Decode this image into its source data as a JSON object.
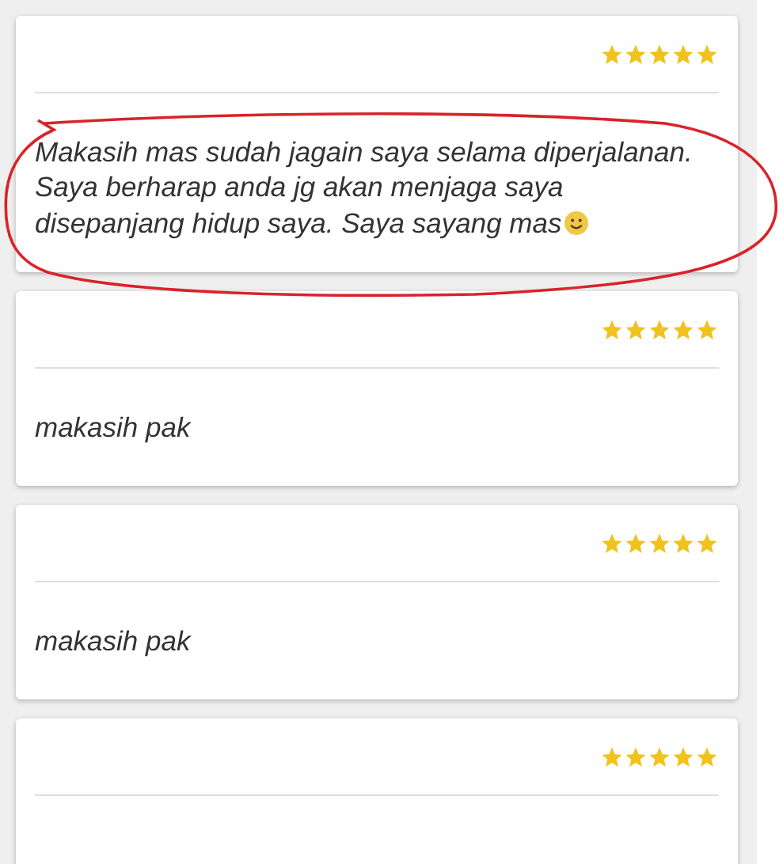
{
  "reviews": [
    {
      "stars": 5,
      "text": "Makasih mas sudah jagain saya selama diperjalanan. Saya berharap anda jg akan menjaga saya disepanjang hidup saya. Saya sayang mas",
      "smiley": true
    },
    {
      "stars": 5,
      "text": "makasih pak",
      "smiley": false
    },
    {
      "stars": 5,
      "text": "makasih pak",
      "smiley": false
    },
    {
      "stars": 5
    }
  ],
  "annotations": [
    {
      "kind": "ellipse",
      "color": "#d9232a"
    }
  ]
}
